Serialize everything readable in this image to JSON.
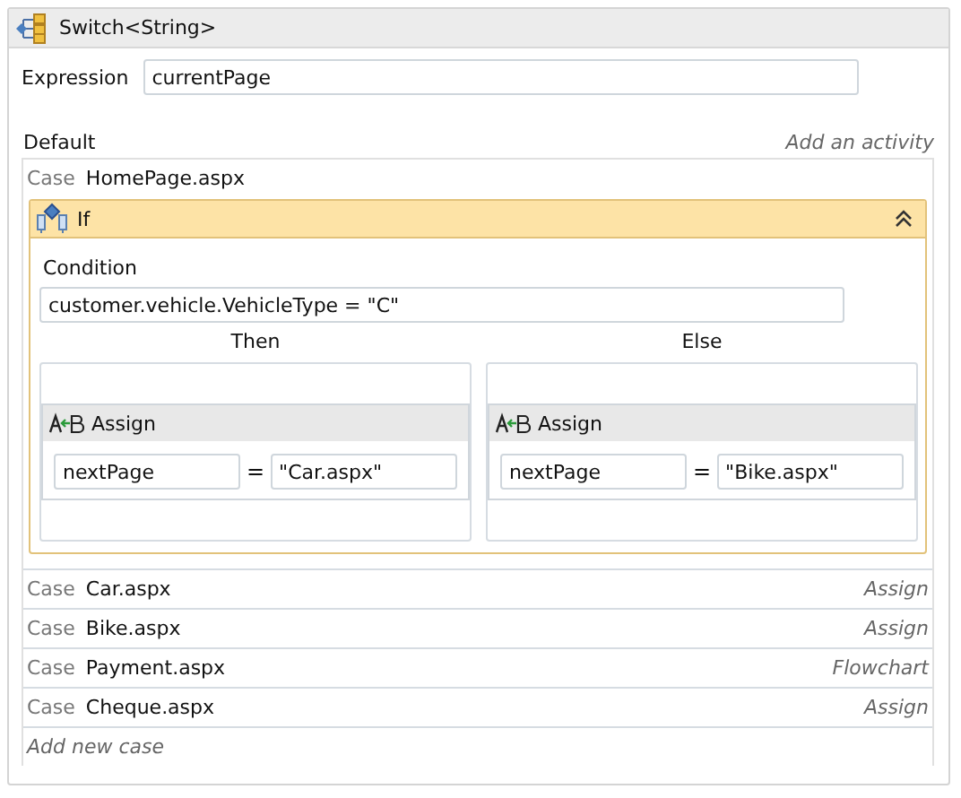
{
  "title": "Switch<String>",
  "expression": {
    "label": "Expression",
    "value": "currentPage"
  },
  "default": {
    "label": "Default",
    "action": "Add an activity"
  },
  "cases": [
    {
      "kind": "expanded",
      "label": "Case",
      "value": "HomePage.aspx",
      "activity": {
        "title": "If",
        "condition_label": "Condition",
        "condition": "customer.vehicle.VehicleType = \"C\"",
        "branches": [
          {
            "label": "Then",
            "title": "Assign",
            "to": "nextPage",
            "op": "=",
            "value": "\"Car.aspx\""
          },
          {
            "label": "Else",
            "title": "Assign",
            "to": "nextPage",
            "op": "=",
            "value": "\"Bike.aspx\""
          }
        ]
      }
    },
    {
      "kind": "collapsed",
      "label": "Case",
      "value": "Car.aspx",
      "activity": "Assign"
    },
    {
      "kind": "collapsed",
      "label": "Case",
      "value": "Bike.aspx",
      "activity": "Assign"
    },
    {
      "kind": "collapsed",
      "label": "Case",
      "value": "Payment.aspx",
      "activity": "Flowchart"
    },
    {
      "kind": "collapsed",
      "label": "Case",
      "value": "Cheque.aspx",
      "activity": "Assign"
    }
  ],
  "add_case": "Add new case"
}
